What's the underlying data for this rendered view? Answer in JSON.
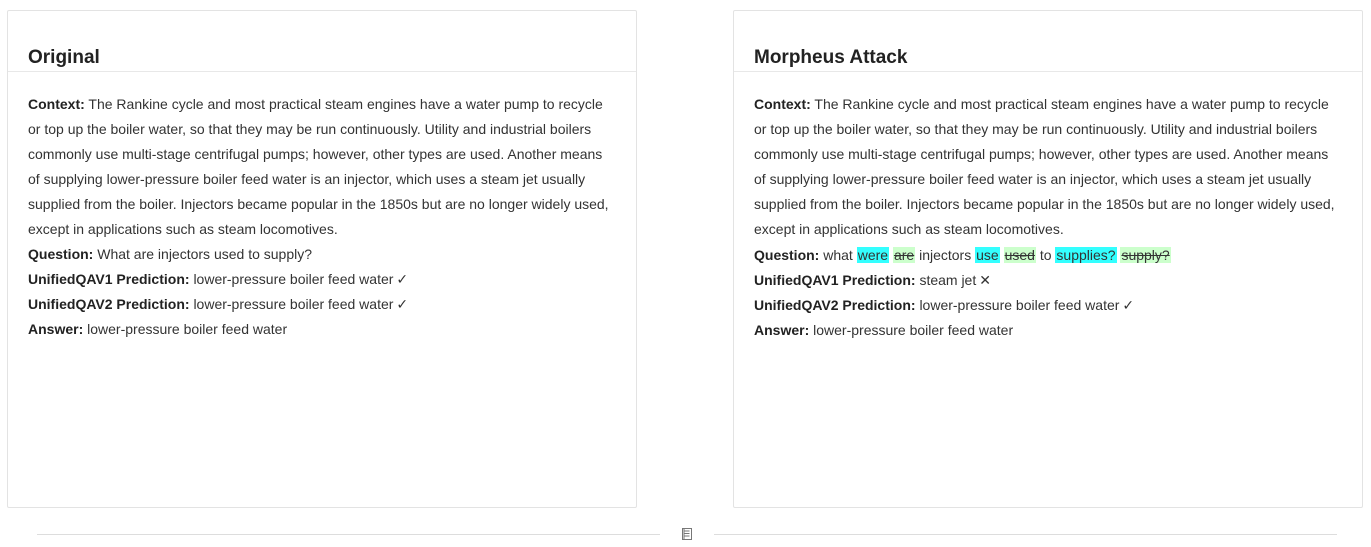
{
  "original": {
    "title": "Original",
    "context_label": "Context:",
    "context": "The Rankine cycle and most practical steam engines have a water pump to recycle or top up the boiler water, so that they may be run continuously. Utility and industrial boilers commonly use multi-stage centrifugal pumps; however, other types are used. Another means of supplying lower-pressure boiler feed water is an injector, which uses a steam jet usually supplied from the boiler. Injectors became popular in the 1850s but are no longer widely used, except in applications such as steam locomotives.",
    "question_label": "Question:",
    "question": "What are injectors used to supply?",
    "pred1_label": "UnifiedQAV1 Prediction:",
    "pred1": "lower-pressure boiler feed water",
    "pred1_mark": "✓",
    "pred2_label": "UnifiedQAV2 Prediction:",
    "pred2": "lower-pressure boiler feed water",
    "pred2_mark": "✓",
    "answer_label": "Answer:",
    "answer": "lower-pressure boiler feed water"
  },
  "attack": {
    "title": "Morpheus Attack",
    "context_label": "Context:",
    "context": "The Rankine cycle and most practical steam engines have a water pump to recycle or top up the boiler water, so that they may be run continuously. Utility and industrial boilers commonly use multi-stage centrifugal pumps; however, other types are used. Another means of supplying lower-pressure boiler feed water is an injector, which uses a steam jet usually supplied from the boiler. Injectors became popular in the 1850s but are no longer widely used, except in applications such as steam locomotives.",
    "question_label": "Question:",
    "question_tokens": {
      "t0": "what",
      "t1_ins": "were",
      "t1_del": "are",
      "t2": "injectors",
      "t3_ins": "use",
      "t3_del": "used",
      "t4": "to",
      "t5_ins": "supplies?",
      "t5_del": "supply?"
    },
    "pred1_label": "UnifiedQAV1 Prediction:",
    "pred1": "steam jet",
    "pred1_mark": "✕",
    "pred2_label": "UnifiedQAV2 Prediction:",
    "pred2": "lower-pressure boiler feed water",
    "pred2_mark": "✓",
    "answer_label": "Answer:",
    "answer": "lower-pressure boiler feed water"
  },
  "colors": {
    "inserted_highlight": "#33ffff",
    "deleted_highlight": "#ccffcc"
  },
  "icons": {
    "divider": "document-icon"
  }
}
